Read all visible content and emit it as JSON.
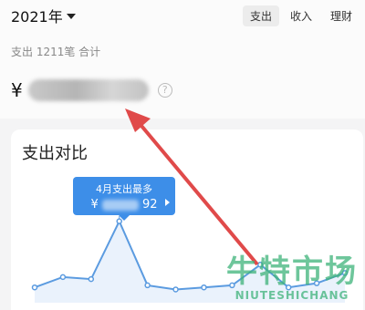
{
  "header": {
    "year": "2021年"
  },
  "tabs": [
    {
      "label": "支出",
      "active": true
    },
    {
      "label": "收入",
      "active": false
    },
    {
      "label": "理财",
      "active": false
    }
  ],
  "summary": {
    "text": "支出 1211笔 合计",
    "currency": "¥",
    "help": "?"
  },
  "chart": {
    "title": "支出对比",
    "tooltip": {
      "title": "4月支出最多",
      "value_prefix": "¥",
      "value_suffix": "92"
    }
  },
  "watermark": {
    "cn": "牛特市场",
    "en": "NIUTESHICHANG"
  },
  "colors": {
    "accent": "#3d8ee8",
    "line": "#5b9be0",
    "arrow": "#e04a4a",
    "watermark": "#3eb37a"
  },
  "chart_data": {
    "type": "line",
    "title": "支出对比",
    "x": [
      1,
      2,
      3,
      4,
      5,
      6,
      7,
      8,
      9,
      10,
      11,
      12
    ],
    "values": [
      6,
      16,
      14,
      70,
      8,
      4,
      6,
      8,
      28,
      6,
      10,
      20
    ],
    "highlight_index": 3,
    "ylim": [
      0,
      75
    ],
    "grid": false
  }
}
